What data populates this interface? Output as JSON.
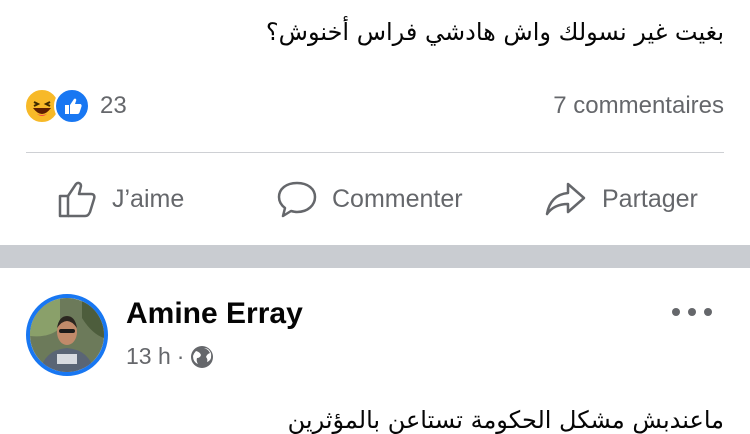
{
  "post1": {
    "text": "بغيت غير نسولك واش هادشي فراس أخنوش؟",
    "reactions": {
      "icons": [
        "haha-icon",
        "like-icon"
      ],
      "count": "23"
    },
    "comments_count": "7 commentaires",
    "actions": {
      "like_label": "J’aime",
      "comment_label": "Commenter",
      "share_label": "Partager"
    }
  },
  "post2": {
    "author": "Amine Erray",
    "time": "13 h",
    "separator": "·",
    "audience_icon": "globe-icon",
    "more_icon": "more-options-icon",
    "text": "ماعندبش مشكل الحكومة تستاعن بالمؤثرين"
  },
  "colors": {
    "facebook_blue": "#1877f2",
    "secondary_text": "#65676b",
    "separator_band": "#c9ccd1",
    "haha_yellow": "#f7b928"
  }
}
